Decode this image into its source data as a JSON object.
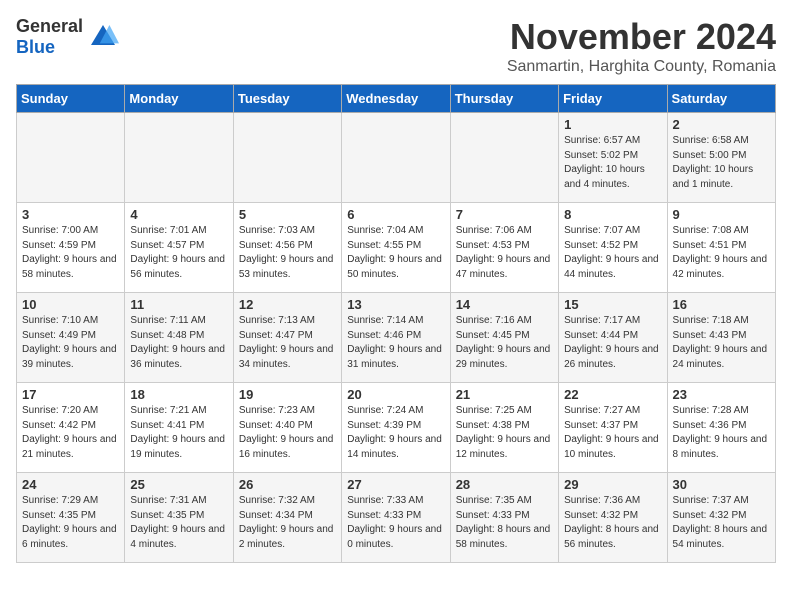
{
  "logo": {
    "text_general": "General",
    "text_blue": "Blue"
  },
  "title": {
    "month_year": "November 2024",
    "location": "Sanmartin, Harghita County, Romania"
  },
  "weekdays": [
    "Sunday",
    "Monday",
    "Tuesday",
    "Wednesday",
    "Thursday",
    "Friday",
    "Saturday"
  ],
  "weeks": [
    [
      {
        "day": "",
        "info": ""
      },
      {
        "day": "",
        "info": ""
      },
      {
        "day": "",
        "info": ""
      },
      {
        "day": "",
        "info": ""
      },
      {
        "day": "",
        "info": ""
      },
      {
        "day": "1",
        "info": "Sunrise: 6:57 AM\nSunset: 5:02 PM\nDaylight: 10 hours and 4 minutes."
      },
      {
        "day": "2",
        "info": "Sunrise: 6:58 AM\nSunset: 5:00 PM\nDaylight: 10 hours and 1 minute."
      }
    ],
    [
      {
        "day": "3",
        "info": "Sunrise: 7:00 AM\nSunset: 4:59 PM\nDaylight: 9 hours and 58 minutes."
      },
      {
        "day": "4",
        "info": "Sunrise: 7:01 AM\nSunset: 4:57 PM\nDaylight: 9 hours and 56 minutes."
      },
      {
        "day": "5",
        "info": "Sunrise: 7:03 AM\nSunset: 4:56 PM\nDaylight: 9 hours and 53 minutes."
      },
      {
        "day": "6",
        "info": "Sunrise: 7:04 AM\nSunset: 4:55 PM\nDaylight: 9 hours and 50 minutes."
      },
      {
        "day": "7",
        "info": "Sunrise: 7:06 AM\nSunset: 4:53 PM\nDaylight: 9 hours and 47 minutes."
      },
      {
        "day": "8",
        "info": "Sunrise: 7:07 AM\nSunset: 4:52 PM\nDaylight: 9 hours and 44 minutes."
      },
      {
        "day": "9",
        "info": "Sunrise: 7:08 AM\nSunset: 4:51 PM\nDaylight: 9 hours and 42 minutes."
      }
    ],
    [
      {
        "day": "10",
        "info": "Sunrise: 7:10 AM\nSunset: 4:49 PM\nDaylight: 9 hours and 39 minutes."
      },
      {
        "day": "11",
        "info": "Sunrise: 7:11 AM\nSunset: 4:48 PM\nDaylight: 9 hours and 36 minutes."
      },
      {
        "day": "12",
        "info": "Sunrise: 7:13 AM\nSunset: 4:47 PM\nDaylight: 9 hours and 34 minutes."
      },
      {
        "day": "13",
        "info": "Sunrise: 7:14 AM\nSunset: 4:46 PM\nDaylight: 9 hours and 31 minutes."
      },
      {
        "day": "14",
        "info": "Sunrise: 7:16 AM\nSunset: 4:45 PM\nDaylight: 9 hours and 29 minutes."
      },
      {
        "day": "15",
        "info": "Sunrise: 7:17 AM\nSunset: 4:44 PM\nDaylight: 9 hours and 26 minutes."
      },
      {
        "day": "16",
        "info": "Sunrise: 7:18 AM\nSunset: 4:43 PM\nDaylight: 9 hours and 24 minutes."
      }
    ],
    [
      {
        "day": "17",
        "info": "Sunrise: 7:20 AM\nSunset: 4:42 PM\nDaylight: 9 hours and 21 minutes."
      },
      {
        "day": "18",
        "info": "Sunrise: 7:21 AM\nSunset: 4:41 PM\nDaylight: 9 hours and 19 minutes."
      },
      {
        "day": "19",
        "info": "Sunrise: 7:23 AM\nSunset: 4:40 PM\nDaylight: 9 hours and 16 minutes."
      },
      {
        "day": "20",
        "info": "Sunrise: 7:24 AM\nSunset: 4:39 PM\nDaylight: 9 hours and 14 minutes."
      },
      {
        "day": "21",
        "info": "Sunrise: 7:25 AM\nSunset: 4:38 PM\nDaylight: 9 hours and 12 minutes."
      },
      {
        "day": "22",
        "info": "Sunrise: 7:27 AM\nSunset: 4:37 PM\nDaylight: 9 hours and 10 minutes."
      },
      {
        "day": "23",
        "info": "Sunrise: 7:28 AM\nSunset: 4:36 PM\nDaylight: 9 hours and 8 minutes."
      }
    ],
    [
      {
        "day": "24",
        "info": "Sunrise: 7:29 AM\nSunset: 4:35 PM\nDaylight: 9 hours and 6 minutes."
      },
      {
        "day": "25",
        "info": "Sunrise: 7:31 AM\nSunset: 4:35 PM\nDaylight: 9 hours and 4 minutes."
      },
      {
        "day": "26",
        "info": "Sunrise: 7:32 AM\nSunset: 4:34 PM\nDaylight: 9 hours and 2 minutes."
      },
      {
        "day": "27",
        "info": "Sunrise: 7:33 AM\nSunset: 4:33 PM\nDaylight: 9 hours and 0 minutes."
      },
      {
        "day": "28",
        "info": "Sunrise: 7:35 AM\nSunset: 4:33 PM\nDaylight: 8 hours and 58 minutes."
      },
      {
        "day": "29",
        "info": "Sunrise: 7:36 AM\nSunset: 4:32 PM\nDaylight: 8 hours and 56 minutes."
      },
      {
        "day": "30",
        "info": "Sunrise: 7:37 AM\nSunset: 4:32 PM\nDaylight: 8 hours and 54 minutes."
      }
    ]
  ]
}
